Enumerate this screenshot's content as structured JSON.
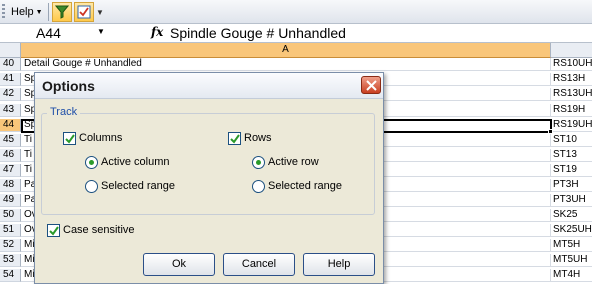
{
  "toolbar": {
    "help_label": "Help",
    "icons": [
      "filter-icon",
      "options-icon"
    ],
    "colors": {
      "icon_highlight": "#ffc94a"
    }
  },
  "formula_bar": {
    "name_box": "A44",
    "fx_label": "fx",
    "formula": "Spindle Gouge # Unhandled"
  },
  "grid": {
    "column_header": "A",
    "active_row": "44",
    "colors": {
      "active_header": "#f9c67a"
    },
    "rows": [
      {
        "num": "40",
        "a": "Detail Gouge # Unhandled",
        "b": "RS10UH"
      },
      {
        "num": "41",
        "a": "Sp",
        "b": "RS13H"
      },
      {
        "num": "42",
        "a": "Sp",
        "b": "RS13UH"
      },
      {
        "num": "43",
        "a": "Sp",
        "b": "RS19H"
      },
      {
        "num": "44",
        "a": "Sp",
        "b": "RS19UH"
      },
      {
        "num": "45",
        "a": "Ti",
        "b": "ST10"
      },
      {
        "num": "46",
        "a": "Ti",
        "b": "ST13"
      },
      {
        "num": "47",
        "a": "Ti",
        "b": "ST19"
      },
      {
        "num": "48",
        "a": "Pa",
        "b": "PT3H"
      },
      {
        "num": "49",
        "a": "Pa",
        "b": "PT3UH"
      },
      {
        "num": "50",
        "a": "Ov",
        "b": "SK25"
      },
      {
        "num": "51",
        "a": "Ov",
        "b": "SK25UH"
      },
      {
        "num": "52",
        "a": "Mi",
        "b": "MT5H"
      },
      {
        "num": "53",
        "a": "Mi",
        "b": "MT5UH"
      },
      {
        "num": "54",
        "a": "Mi",
        "b": "MT4H"
      }
    ]
  },
  "dialog": {
    "title": "Options",
    "group_label": "Track",
    "columns_label": "Columns",
    "rows_label": "Rows",
    "active_column_label": "Active column",
    "selected_range_col_label": "Selected range",
    "active_row_label": "Active row",
    "selected_range_row_label": "Selected range",
    "case_sensitive_label": "Case sensitive",
    "ok_label": "Ok",
    "cancel_label": "Cancel",
    "help_label": "Help",
    "state": {
      "columns_checked": true,
      "rows_checked": true,
      "case_sensitive_checked": true,
      "col_track": "Active column",
      "row_track": "Active row"
    },
    "colors": {
      "close_button": "#c83e20",
      "group_label": "#1f4fa8",
      "radio_dot": "#2a9a2a"
    }
  }
}
